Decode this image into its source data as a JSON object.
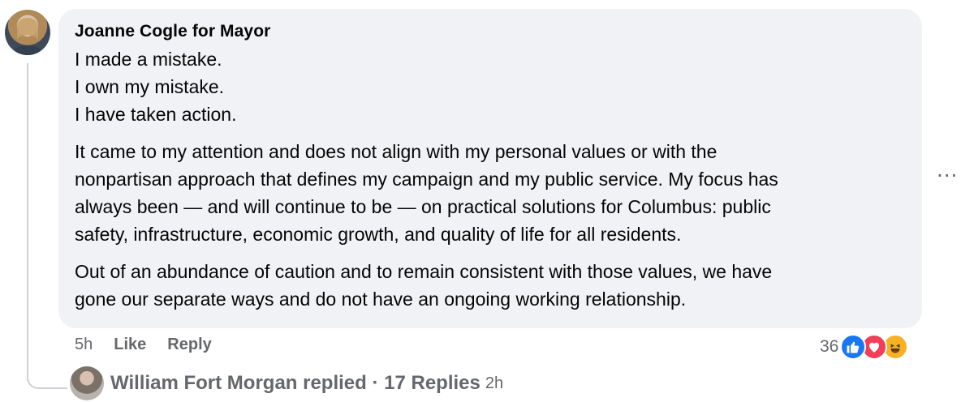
{
  "comment": {
    "author": "Joanne Cogle for Mayor",
    "lines": [
      "I made a mistake.",
      "I own my mistake.",
      "I have taken action."
    ],
    "paragraph2": [
      "It came to my attention and does not align with my personal values or with the",
      "nonpartisan approach that defines my campaign and my public service. My focus has",
      "always been — and will continue to be — on practical solutions for Columbus: public",
      "safety, infrastructure, economic growth, and quality of life for all residents."
    ],
    "paragraph3": [
      "Out of an abundance of caution and to remain consistent with those values, we have",
      "gone our separate ways and do not have an ongoing working relationship."
    ],
    "more_label": "...",
    "time": "5h",
    "like_label": "Like",
    "reply_label": "Reply",
    "reaction_count": "36",
    "reaction_icons": [
      "like-icon",
      "love-icon",
      "haha-icon"
    ]
  },
  "reply_summary": {
    "text": "William Fort Morgan replied · 17 Replies",
    "time": "2h"
  },
  "colors": {
    "bubble": "#f0f2f5",
    "meta": "#65676b",
    "like": "#1877f2",
    "love": "#f33e58",
    "haha": "#f7b125"
  }
}
